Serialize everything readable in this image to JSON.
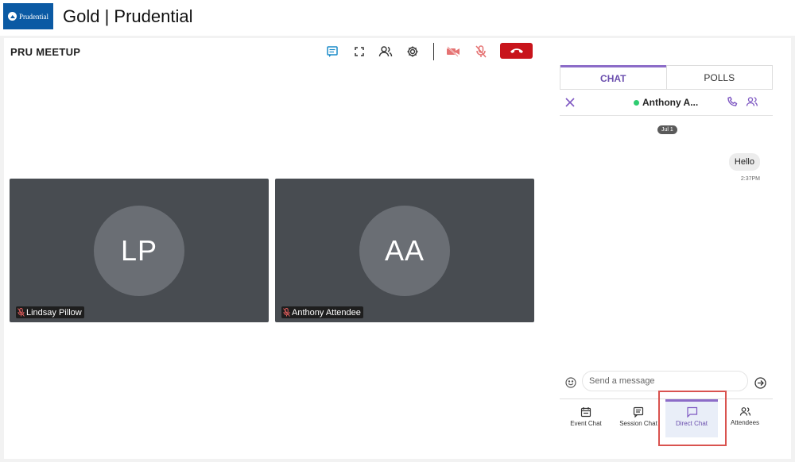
{
  "app": {
    "logo_text": "Prudential",
    "title": "Gold | Prudential"
  },
  "meeting": {
    "title": "PRU MEETUP",
    "toolbar_icons": [
      "chat-icon",
      "fullscreen-icon",
      "people-icon",
      "settings-icon",
      "video-off-icon",
      "mic-off-icon",
      "end-call-icon"
    ]
  },
  "participants": [
    {
      "initials": "LP",
      "name": "Lindsay Pillow",
      "muted": true
    },
    {
      "initials": "AA",
      "name": "Anthony Attendee",
      "muted": true
    }
  ],
  "chat": {
    "tabs": [
      {
        "label": "CHAT",
        "active": true
      },
      {
        "label": "POLLS",
        "active": false
      }
    ],
    "peer_name": "Anthony A...",
    "peer_status_color": "#2ecc71",
    "date_label": "Jul 1",
    "messages": [
      {
        "text": "Hello",
        "time": "2:37PM"
      }
    ],
    "input_placeholder": "Send a message",
    "nav": [
      {
        "label": "Event Chat",
        "icon": "calendar-icon"
      },
      {
        "label": "Session Chat",
        "icon": "message-square-icon"
      },
      {
        "label": "Direct Chat",
        "icon": "chat-bubble-icon",
        "active": true
      },
      {
        "label": "Attendees",
        "icon": "people-icon"
      }
    ]
  },
  "colors": {
    "accent": "#8c6cc8",
    "end_call": "#c8141b",
    "tile_bg": "#484c51",
    "brand": "#0b5aa4"
  }
}
